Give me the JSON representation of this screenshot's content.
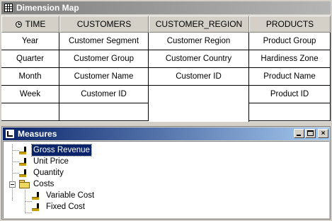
{
  "dimension_map": {
    "title": "Dimension Map",
    "columns": [
      {
        "header": "TIME",
        "icon": "clock-icon",
        "items": [
          "Year",
          "Quarter",
          "Month",
          "Week"
        ]
      },
      {
        "header": "CUSTOMERS",
        "items": [
          "Customer Segment",
          "Customer Group",
          "Customer Name",
          "Customer ID"
        ]
      },
      {
        "header": "CUSTOMER_REGION",
        "items": [
          "Customer Region",
          "Customer Country",
          "Customer ID"
        ]
      },
      {
        "header": "PRODUCTS",
        "items": [
          "Product Group",
          "Hardiness Zone",
          "Product Name",
          "Product ID"
        ]
      }
    ]
  },
  "measures": {
    "title": "Measures",
    "buttons": {
      "minimize": "minimize",
      "maximize": "maximize",
      "close": "×"
    },
    "items": [
      {
        "label": "Gross Revenue",
        "selected": true
      },
      {
        "label": "Unit Price"
      },
      {
        "label": "Quantity"
      },
      {
        "label": "Costs",
        "folder": true,
        "children": [
          {
            "label": "Variable Cost"
          },
          {
            "label": "Fixed Cost"
          }
        ]
      }
    ]
  },
  "colors": {
    "active_title": "#0a246a",
    "inactive_title": "#808080",
    "face": "#d4d0c8"
  }
}
